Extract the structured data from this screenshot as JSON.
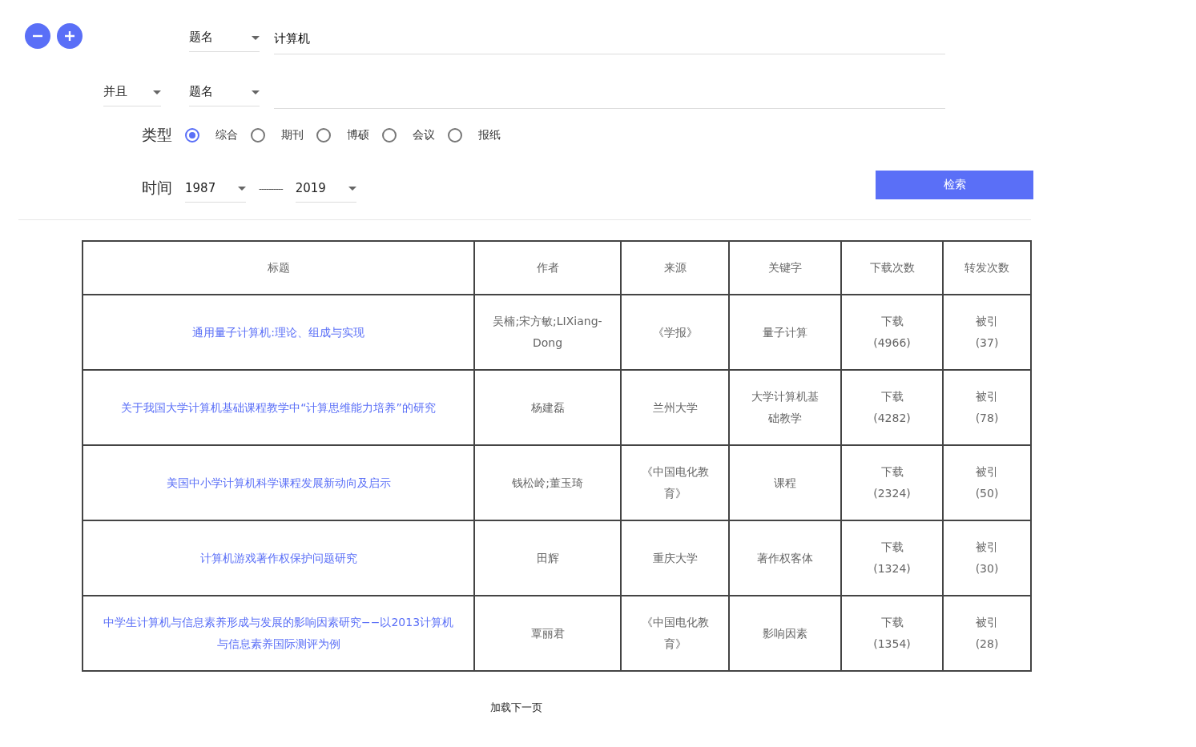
{
  "search_rows": [
    {
      "logic": null,
      "field": "题名",
      "value": "计算机"
    },
    {
      "logic": "并且",
      "field": "题名",
      "value": ""
    }
  ],
  "type_filter": {
    "label": "类型",
    "options": [
      {
        "label": "综合",
        "selected": true
      },
      {
        "label": "期刊",
        "selected": false
      },
      {
        "label": "博硕",
        "selected": false
      },
      {
        "label": "会议",
        "selected": false
      },
      {
        "label": "报纸",
        "selected": false
      }
    ]
  },
  "time_filter": {
    "label": "时间",
    "from": "1987",
    "separator": "----------",
    "to": "2019"
  },
  "search_button": "检索",
  "table": {
    "columns": [
      "标题",
      "作者",
      "来源",
      "关键字",
      "下载次数",
      "转发次数"
    ],
    "rows": [
      {
        "title": "通用量子计算机:理论、组成与实现",
        "author": "吴楠;宋方敏;LIXiang-Dong",
        "source": "《学报》",
        "keyword": "量子计算",
        "download_label": "下载",
        "downloads": "(4966)",
        "cite_label": "被引",
        "citations": "(37)"
      },
      {
        "title": "关于我国大学计算机基础课程教学中“计算思维能力培养”的研究",
        "author": "杨建磊",
        "source": "兰州大学",
        "keyword": "大学计算机基础教学",
        "download_label": "下载",
        "downloads": "(4282)",
        "cite_label": "被引",
        "citations": "(78)"
      },
      {
        "title": "美国中小学计算机科学课程发展新动向及启示",
        "author": "钱松岭;董玉琦",
        "source": "《中国电化教育》",
        "keyword": "课程",
        "download_label": "下载",
        "downloads": "(2324)",
        "cite_label": "被引",
        "citations": "(50)"
      },
      {
        "title": "计算机游戏著作权保护问题研究",
        "author": "田辉",
        "source": "重庆大学",
        "keyword": "著作权客体",
        "download_label": "下载",
        "downloads": "(1324)",
        "cite_label": "被引",
        "citations": "(30)"
      },
      {
        "title": "中学生计算机与信息素养形成与发展的影响因素研究−−以2013计算机与信息素养国际测评为例",
        "author": "覃丽君",
        "source": "《中国电化教育》",
        "keyword": "影响因素",
        "download_label": "下载",
        "downloads": "(1354)",
        "cite_label": "被引",
        "citations": "(28)"
      }
    ]
  },
  "load_more": "加载下一页"
}
